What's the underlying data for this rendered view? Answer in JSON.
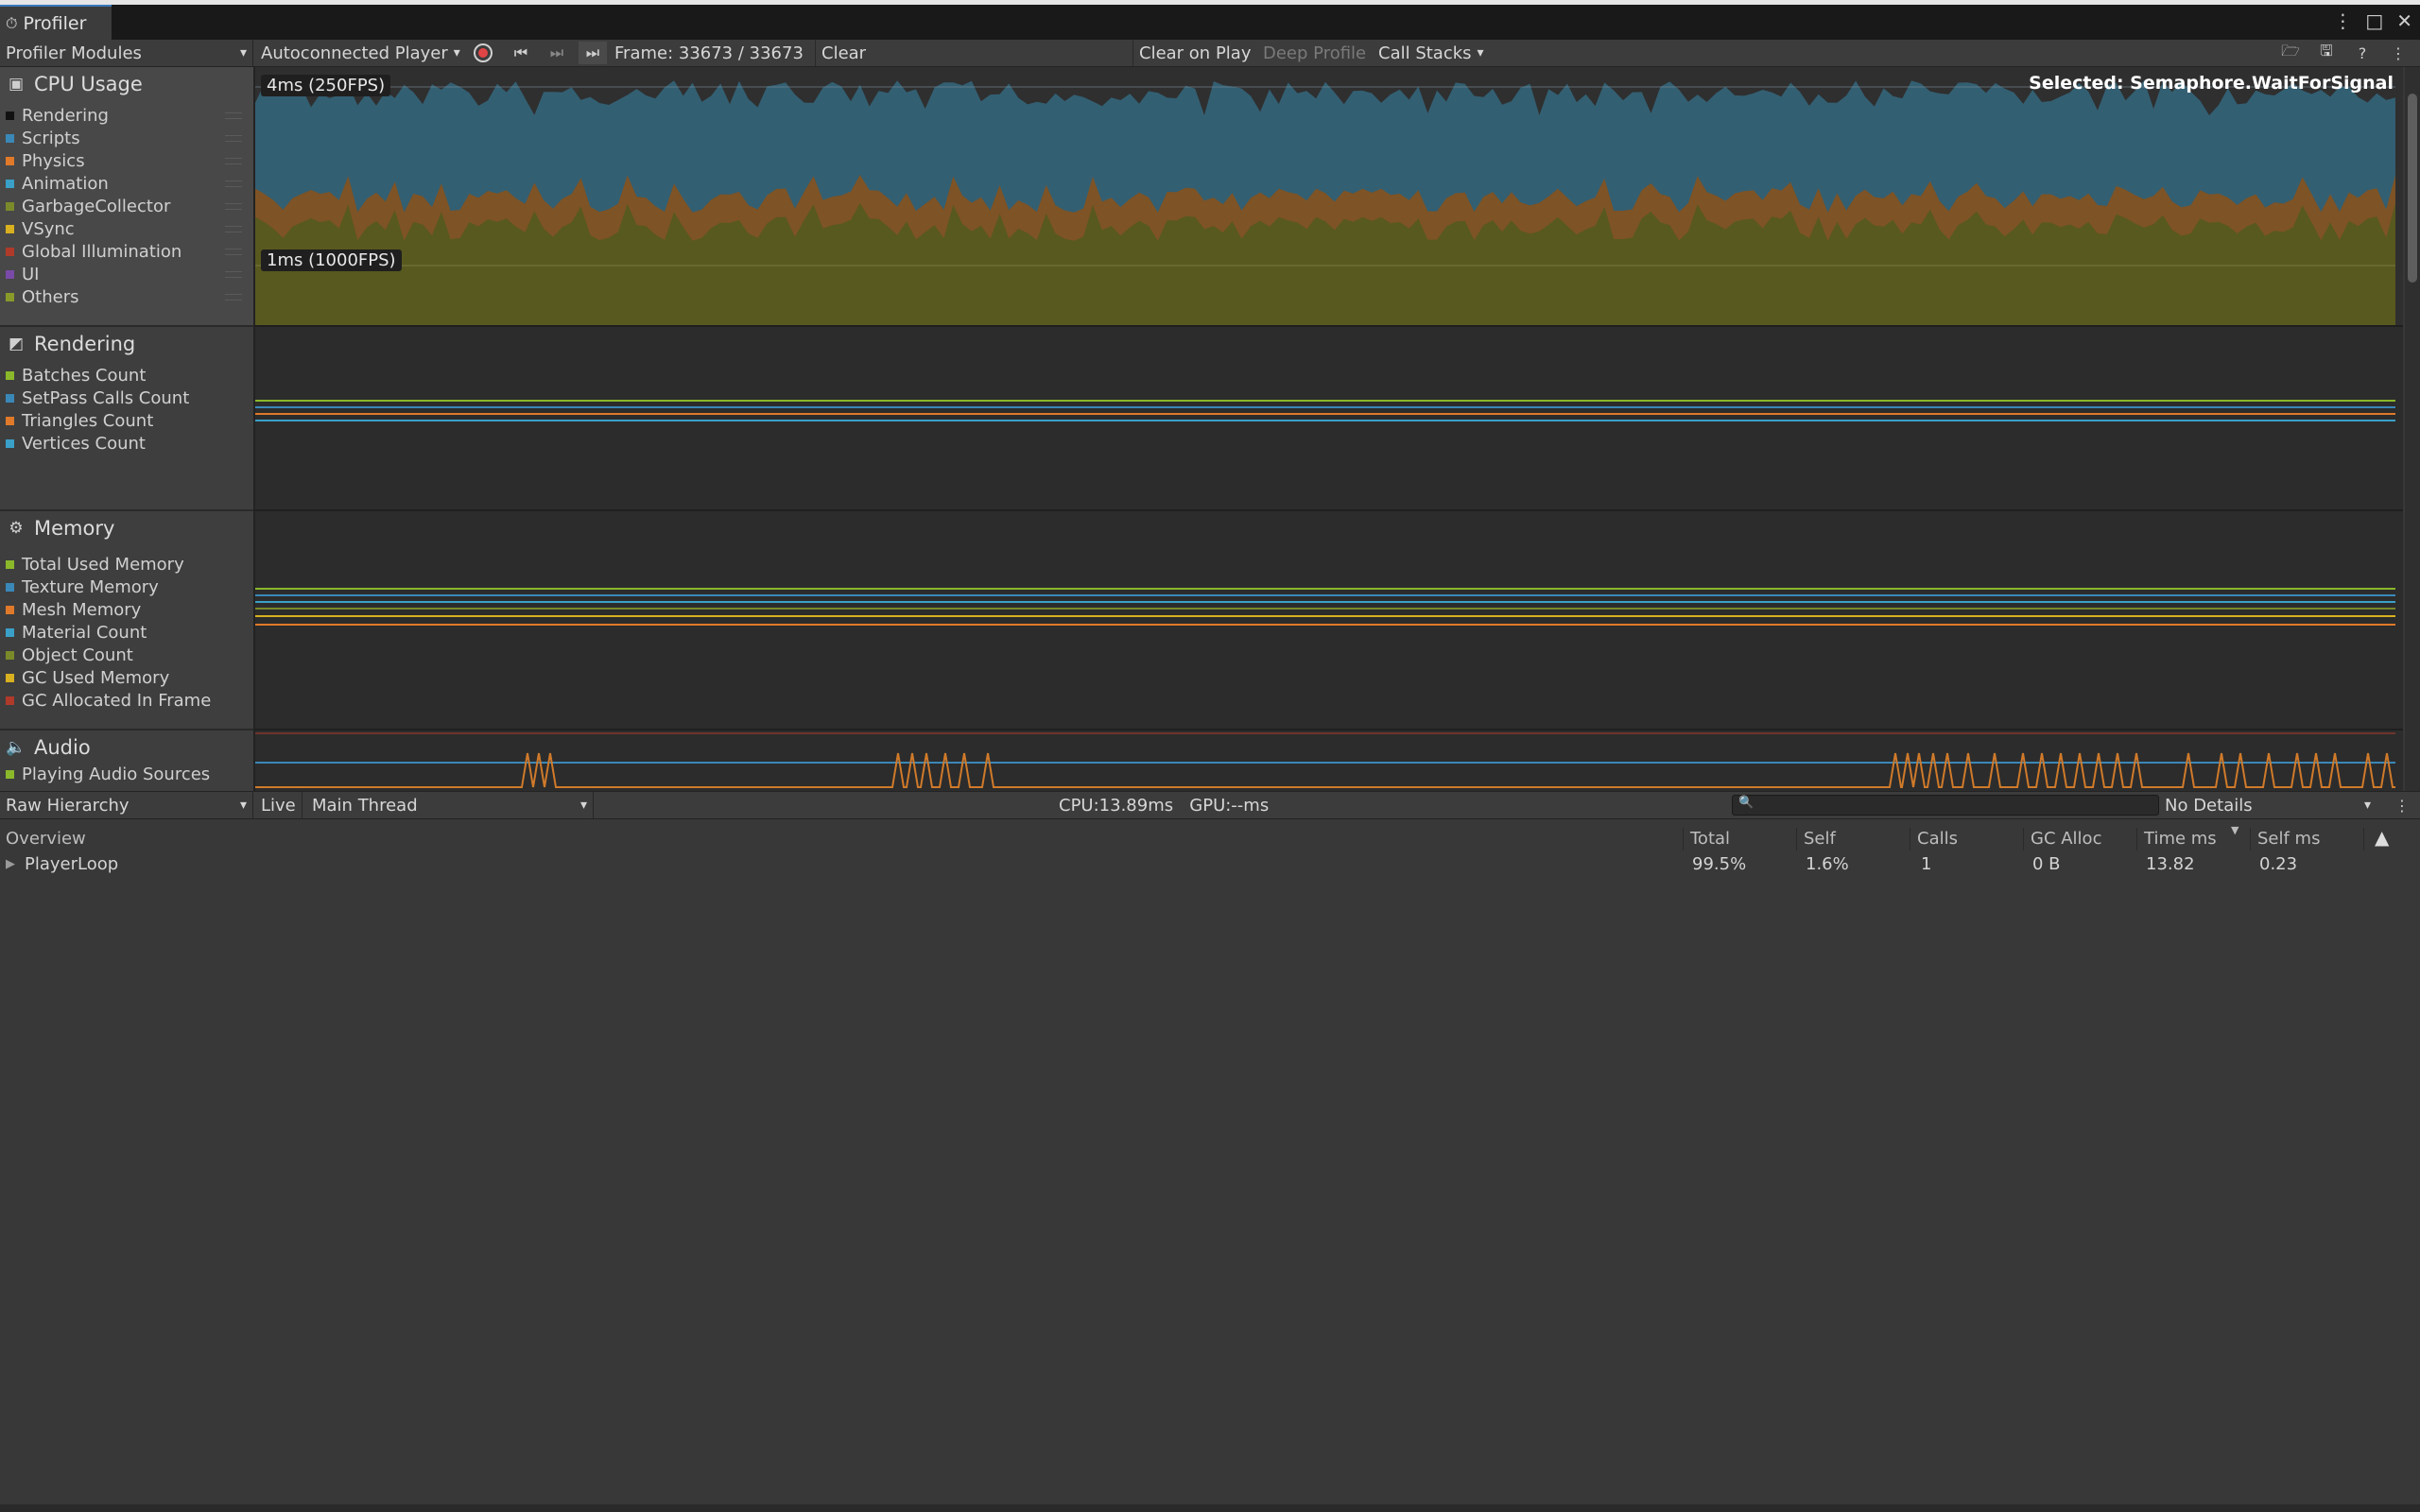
{
  "window": {
    "tab_title": "Profiler"
  },
  "toolbar": {
    "modules_label": "Profiler Modules",
    "target_label": "Autoconnected Player",
    "frame_label": "Frame: 33673 / 33673",
    "clear_label": "Clear",
    "clear_on_play_label": "Clear on Play",
    "deep_profile_label": "Deep Profile",
    "call_stacks_label": "Call Stacks"
  },
  "modules": {
    "cpu": {
      "title": "CPU Usage",
      "items": [
        {
          "label": "Rendering",
          "color": "#111111"
        },
        {
          "label": "Scripts",
          "color": "#3a88b8"
        },
        {
          "label": "Physics",
          "color": "#e07a2a"
        },
        {
          "label": "Animation",
          "color": "#3aa0c8"
        },
        {
          "label": "GarbageCollector",
          "color": "#7a8a2a"
        },
        {
          "label": "VSync",
          "color": "#d8b020"
        },
        {
          "label": "Global Illumination",
          "color": "#b03a2a"
        },
        {
          "label": "UI",
          "color": "#7a4aa8"
        },
        {
          "label": "Others",
          "color": "#8a9a2a"
        }
      ]
    },
    "rendering": {
      "title": "Rendering",
      "items": [
        {
          "label": "Batches Count",
          "color": "#8ab82a"
        },
        {
          "label": "SetPass Calls Count",
          "color": "#3a88b8"
        },
        {
          "label": "Triangles Count",
          "color": "#e07a2a"
        },
        {
          "label": "Vertices Count",
          "color": "#3aa0c8"
        }
      ]
    },
    "memory": {
      "title": "Memory",
      "items": [
        {
          "label": "Total Used Memory",
          "color": "#8ab82a"
        },
        {
          "label": "Texture Memory",
          "color": "#3a88b8"
        },
        {
          "label": "Mesh Memory",
          "color": "#e07a2a"
        },
        {
          "label": "Material Count",
          "color": "#3aa0c8"
        },
        {
          "label": "Object Count",
          "color": "#7a8a2a"
        },
        {
          "label": "GC Used Memory",
          "color": "#d8b020"
        },
        {
          "label": "GC Allocated In Frame",
          "color": "#b03a2a"
        }
      ]
    },
    "audio": {
      "title": "Audio",
      "items": [
        {
          "label": "Playing Audio Sources",
          "color": "#8ab82a"
        }
      ]
    }
  },
  "cpu_chart": {
    "label_top": "4ms (250FPS)",
    "label_mid": "1ms (1000FPS)",
    "selected_label": "Selected: Semaphore.WaitForSignal",
    "colors": {
      "scripts": "#335f72",
      "physics": "#7e5325",
      "others": "#58591f"
    }
  },
  "details": {
    "view_label": "Raw Hierarchy",
    "live_label": "Live",
    "thread_label": "Main Thread",
    "cpu_gpu_label": "CPU:13.89ms   GPU:--ms",
    "details_label": "No Details",
    "columns": [
      "Overview",
      "Total",
      "Self",
      "Calls",
      "GC Alloc",
      "Time ms",
      "Self ms"
    ],
    "rows": [
      {
        "name": "PlayerLoop",
        "total": "99.5%",
        "self": "1.6%",
        "calls": "1",
        "gc_alloc": "0 B",
        "time_ms": "13.82",
        "self_ms": "0.23"
      }
    ]
  }
}
